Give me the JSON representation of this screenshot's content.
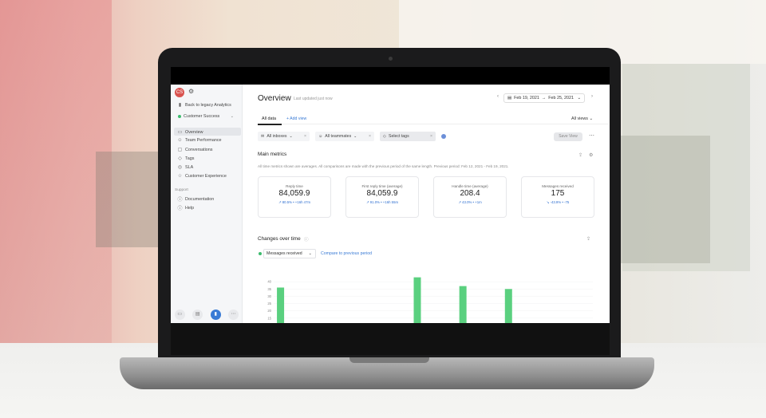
{
  "app": {
    "sidebar": {
      "avatar": "CS",
      "back_link": "Back to legacy Analytics",
      "team": "Customer Success",
      "nav": [
        {
          "label": "Overview",
          "icon": "inbox-icon",
          "glyph": "▭"
        },
        {
          "label": "Team Performance",
          "icon": "user-icon",
          "glyph": "☺"
        },
        {
          "label": "Conversations",
          "icon": "chat-icon",
          "glyph": "▢"
        },
        {
          "label": "Tags",
          "icon": "tag-icon",
          "glyph": "◇"
        },
        {
          "label": "SLA",
          "icon": "shield-icon",
          "glyph": "◎"
        },
        {
          "label": "Customer Experience",
          "icon": "star-icon",
          "glyph": "☆"
        }
      ],
      "support_header": "Support",
      "support": [
        {
          "label": "Documentation",
          "icon": "info-icon",
          "glyph": "ⓘ"
        },
        {
          "label": "Help",
          "icon": "info-icon",
          "glyph": "ⓘ"
        }
      ]
    },
    "header": {
      "title": "Overview",
      "updated": "Last updated just now",
      "date_from": "Feb 19, 2021",
      "date_to": "Feb 25, 2021"
    },
    "tabs": {
      "all_data": "All data",
      "add_view": "+ Add view",
      "all_views": "All views"
    },
    "filters": {
      "inboxes": "All inboxes",
      "teammates": "All teammates",
      "tags": "Select tags",
      "save_view": "Save View"
    },
    "metrics": {
      "title": "Main metrics",
      "description": "All time metrics shown are averages. All comparisons are made with the previous period of the same length. Previous period: Feb 12, 2021 - Feb 19, 2021.",
      "cards": [
        {
          "label": "Reply time",
          "value": "84,059.9",
          "change": "↗ 80.5% • +16h 47m"
        },
        {
          "label": "First reply time (average)",
          "value": "84,059.9",
          "change": "↗ 91.0% • +16h 55m"
        },
        {
          "label": "Handle time (average)",
          "value": "208.4",
          "change": "↗ 43.0% • +1m"
        },
        {
          "label": "Messages received",
          "value": "175",
          "change": "↘ -43.9% • -75"
        }
      ]
    },
    "changes": {
      "title": "Changes over time",
      "series_select": "Messages received",
      "compare": "Compare to previous period"
    }
  },
  "chart_data": {
    "type": "bar",
    "series": [
      {
        "name": "Messages received",
        "color": "#5ad07f"
      }
    ],
    "x_index": [
      0,
      1,
      2,
      3,
      4,
      5,
      6
    ],
    "values": [
      36,
      null,
      null,
      43,
      37,
      35,
      null
    ],
    "yticks": [
      "40",
      "35",
      "30",
      "25",
      "20",
      "15",
      "10"
    ],
    "ylim": [
      10,
      45
    ]
  }
}
